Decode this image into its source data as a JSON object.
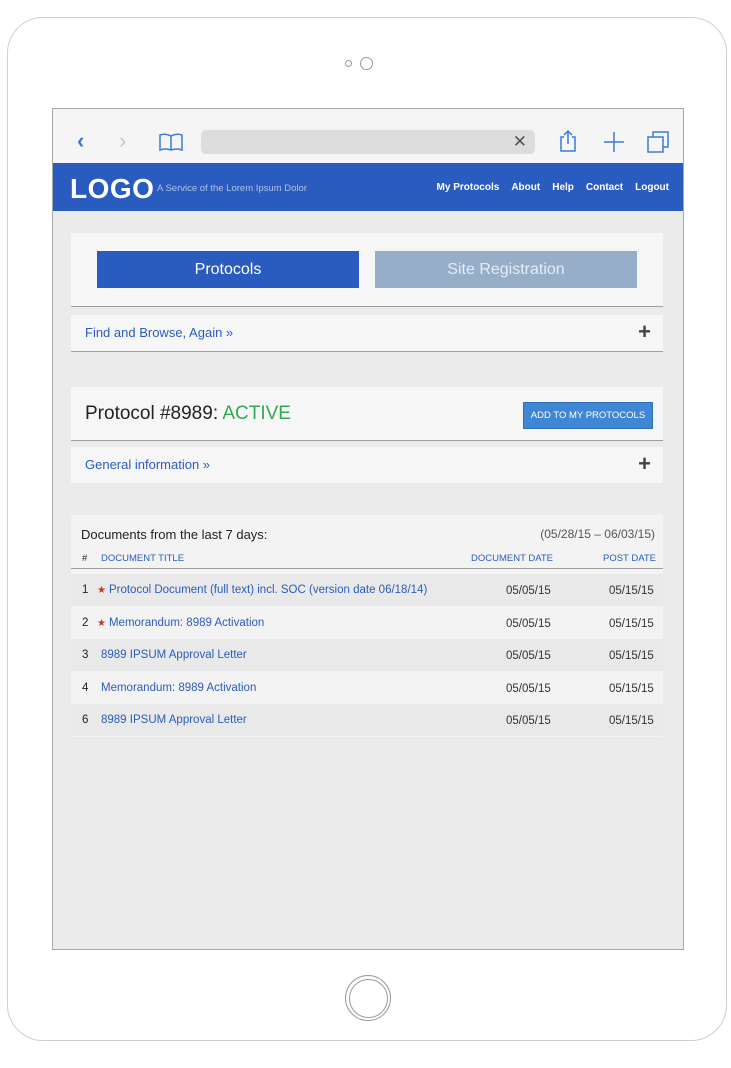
{
  "browser": {
    "back_glyph": "‹",
    "forward_glyph": "›",
    "url_clear_glyph": "✕",
    "icons": [
      "back-icon",
      "forward-icon",
      "bookmarks-icon",
      "share-icon",
      "new-tab-icon",
      "tabs-icon"
    ]
  },
  "header": {
    "logo": "LOGO",
    "tagline": "A Service of the Lorem Ipsum Dolor",
    "nav": [
      "My Protocols",
      "About",
      "Help",
      "Contact",
      "Logout"
    ]
  },
  "tabs": {
    "protocols": "Protocols",
    "site_registration": "Site Registration"
  },
  "find_bar": {
    "label": "Find and Browse, Again »",
    "toggle": "+"
  },
  "protocol": {
    "title": "Protocol #8989: ",
    "status": "ACTIVE",
    "add_button": "ADD TO MY PROTOCOLS"
  },
  "general_bar": {
    "label": "General information »",
    "toggle": "+"
  },
  "documents": {
    "heading": "Documents from the last 7 days:",
    "range": "(05/28/15 – 06/03/15)",
    "columns": {
      "num": "#",
      "title": "DOCUMENT TITLE",
      "date": "DOCUMENT DATE",
      "post": "POST DATE"
    },
    "rows": [
      {
        "num": "1",
        "starred": true,
        "title": "Protocol Document (full text) incl. SOC (version date 06/18/14)",
        "date": "05/05/15",
        "post": "05/15/15"
      },
      {
        "num": "2",
        "starred": true,
        "title": "Memorandum: 8989 Activation",
        "date": "05/05/15",
        "post": "05/15/15"
      },
      {
        "num": "3",
        "starred": false,
        "title": "8989 IPSUM Approval Letter",
        "date": "05/05/15",
        "post": "05/15/15"
      },
      {
        "num": "4",
        "starred": false,
        "title": "Memorandum: 8989 Activation",
        "date": "05/05/15",
        "post": "05/15/15"
      },
      {
        "num": "6",
        "starred": false,
        "title": "8989 IPSUM Approval Letter",
        "date": "05/05/15",
        "post": "05/15/15"
      }
    ]
  },
  "colors": {
    "brand_blue": "#2a5cbf",
    "active_green": "#34a853",
    "star_red": "#c0392b",
    "tab_inactive": "#97aec8"
  }
}
